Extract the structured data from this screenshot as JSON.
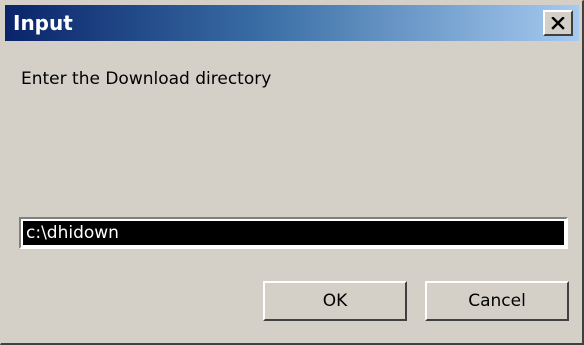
{
  "window": {
    "title": "Input",
    "close_icon": "close-icon"
  },
  "dialog": {
    "prompt": "Enter the Download directory",
    "input_value": "c:\\dhidown",
    "ok_label": "OK",
    "cancel_label": "Cancel"
  },
  "colors": {
    "titlebar_start": "#0a246a",
    "titlebar_end": "#a6caf0",
    "face": "#d4d0c8",
    "input_selection_bg": "#000000",
    "input_selection_text": "#ffffff"
  }
}
